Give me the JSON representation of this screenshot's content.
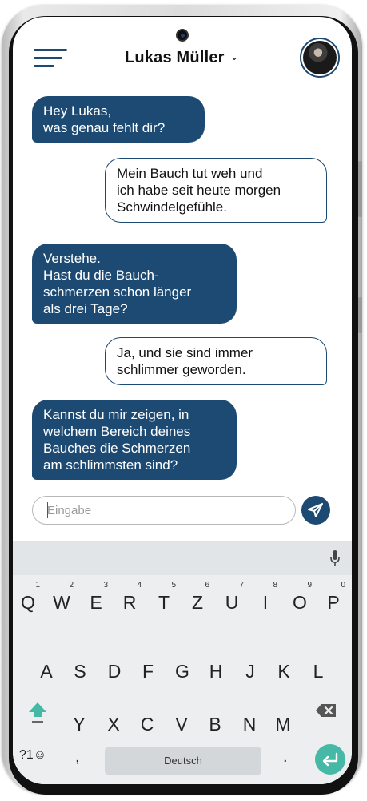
{
  "header": {
    "contact_name": "Lukas Müller",
    "chevron": "⌄",
    "menu_icon": "hamburger-menu-icon",
    "avatar_alt": "contact-avatar"
  },
  "messages": [
    {
      "direction": "in",
      "lines": [
        "Hey Lukas,",
        "was genau fehlt dir?"
      ]
    },
    {
      "direction": "out",
      "lines": [
        "Mein Bauch tut weh und",
        "ich habe seit heute morgen",
        "Schwindelgefühle."
      ]
    },
    {
      "direction": "in",
      "lines": [
        "Verstehe.",
        "Hast du die Bauch-",
        "schmerzen schon länger",
        "als drei Tage?"
      ]
    },
    {
      "direction": "out",
      "lines": [
        "Ja, und sie sind immer",
        "schlimmer geworden."
      ]
    },
    {
      "direction": "in",
      "lines": [
        "Kannst du mir zeigen, in",
        "welchem Bereich deines",
        "Bauches die Schmerzen",
        "am schlimmsten sind?"
      ]
    }
  ],
  "composer": {
    "placeholder": "Eingabe",
    "value": "",
    "send_icon": "paper-plane-icon"
  },
  "keyboard": {
    "row1": [
      {
        "key": "Q",
        "num": "1"
      },
      {
        "key": "W",
        "num": "2"
      },
      {
        "key": "E",
        "num": "3"
      },
      {
        "key": "R",
        "num": "4"
      },
      {
        "key": "T",
        "num": "5"
      },
      {
        "key": "Z",
        "num": "6"
      },
      {
        "key": "U",
        "num": "7"
      },
      {
        "key": "I",
        "num": "8"
      },
      {
        "key": "O",
        "num": "9"
      },
      {
        "key": "P",
        "num": "0"
      }
    ],
    "row2": [
      "A",
      "S",
      "D",
      "F",
      "G",
      "H",
      "J",
      "K",
      "L"
    ],
    "row3": [
      "Y",
      "X",
      "C",
      "V",
      "B",
      "N",
      "M"
    ],
    "symbols_label": "?1☺",
    "comma_label": ",",
    "space_label": "Deutsch",
    "period_label": ".",
    "mic_icon": "microphone-icon",
    "shift_icon": "shift-arrow-icon",
    "backspace_icon": "backspace-icon",
    "enter_icon": "enter-return-icon"
  },
  "colors": {
    "accent": "#1d4a73",
    "enter": "#45b8a6",
    "keyboard_bg": "#eceeef"
  }
}
